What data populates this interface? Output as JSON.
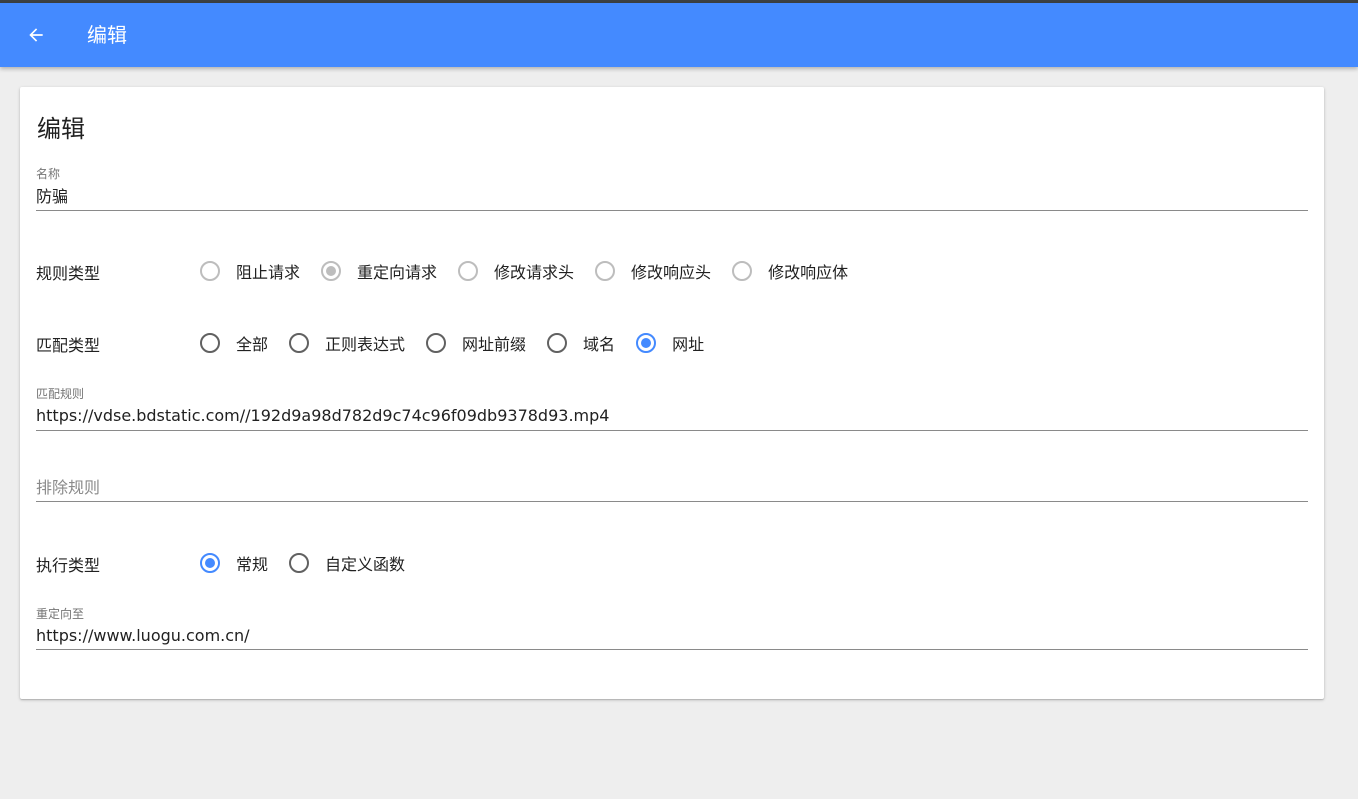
{
  "appbar": {
    "title": "编辑",
    "back_icon": "arrow-left-icon",
    "color": "#448aff"
  },
  "card": {
    "title": "编辑",
    "name_field": {
      "label": "名称",
      "value": "防骗"
    },
    "rule_type": {
      "label": "规则类型",
      "options": [
        "阻止请求",
        "重定向请求",
        "修改请求头",
        "修改响应头",
        "修改响应体"
      ],
      "selected": "重定向请求",
      "disabled": true
    },
    "match_type": {
      "label": "匹配类型",
      "options": [
        "全部",
        "正则表达式",
        "网址前缀",
        "域名",
        "网址"
      ],
      "selected": "网址"
    },
    "match_rule": {
      "label": "匹配规则",
      "value": "https://vdse.bdstatic.com//192d9a98d782d9c74c96f09db9378d93.mp4"
    },
    "exclude_rule": {
      "placeholder": "排除规则",
      "value": ""
    },
    "exec_type": {
      "label": "执行类型",
      "options": [
        "常规",
        "自定义函数"
      ],
      "selected": "常规"
    },
    "redirect_to": {
      "label": "重定向至",
      "value": "https://www.luogu.com.cn/"
    }
  }
}
